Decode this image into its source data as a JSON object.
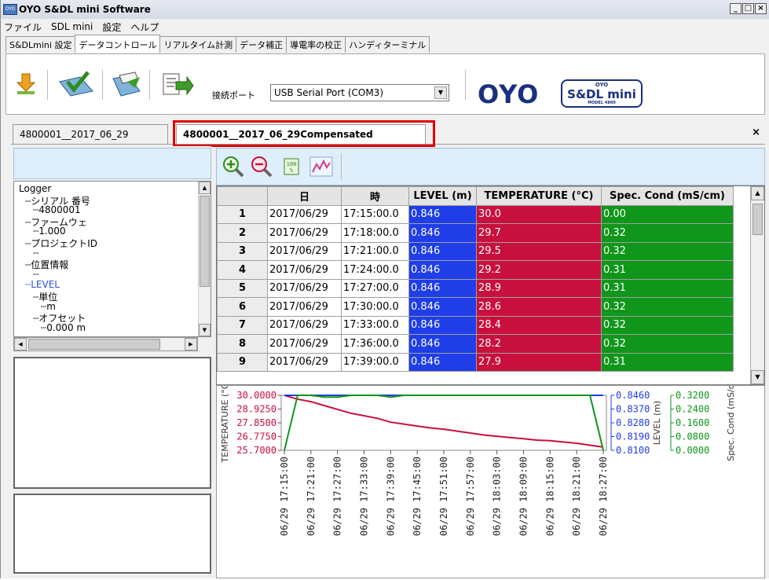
{
  "window": {
    "title": "OYO S&DL mini Software",
    "app_icon": "OYO",
    "buttons": [
      "_",
      "□",
      "×"
    ]
  },
  "menu": [
    "ファイル",
    "SDL mini",
    "設定",
    "ヘルプ"
  ],
  "tabs": [
    {
      "label": "S&DLmini 設定",
      "active": false
    },
    {
      "label": "データコントロール",
      "active": true
    },
    {
      "label": "リアルタイム計測",
      "active": false
    },
    {
      "label": "データ補正",
      "active": false
    },
    {
      "label": "導電率の校正",
      "active": false
    },
    {
      "label": "ハンディターミナル",
      "active": false
    }
  ],
  "toolbar": {
    "port_label": "接続ポート",
    "port_value": "USB Serial Port (COM3)",
    "logo_oyo": "OYO",
    "logo_sdl": "S&DL mini",
    "logo_sdl_top": "OYO",
    "logo_sdl_bottom": "MODEL 4800"
  },
  "doc_tabs": [
    {
      "label": "4800001__2017_06_29",
      "active": false
    },
    {
      "label": "4800001__2017_06_29Compensated",
      "active": true
    }
  ],
  "doc_close": "×",
  "tree": [
    {
      "text": "Logger",
      "level": 0,
      "color": "#000"
    },
    {
      "text": "シリアル 番号",
      "level": 1,
      "color": "#000"
    },
    {
      "text": "4800001",
      "level": 2,
      "color": "#000"
    },
    {
      "text": "ファームウェ",
      "level": 1,
      "color": "#000"
    },
    {
      "text": "1.000",
      "level": 2,
      "color": "#000"
    },
    {
      "text": "プロジェクトID",
      "level": 1,
      "color": "#000"
    },
    {
      "text": "",
      "level": 2,
      "color": "#000"
    },
    {
      "text": "位置情報",
      "level": 1,
      "color": "#000"
    },
    {
      "text": "",
      "level": 2,
      "color": "#000"
    },
    {
      "text": "LEVEL",
      "level": 1,
      "color": "#2b50d8"
    },
    {
      "text": "単位",
      "level": 2,
      "color": "#000"
    },
    {
      "text": "m",
      "level": 3,
      "color": "#000"
    },
    {
      "text": "オフセット",
      "level": 2,
      "color": "#000"
    },
    {
      "text": "0.000 m",
      "level": 3,
      "color": "#000"
    }
  ],
  "grid": {
    "columns": [
      "",
      "日",
      "時",
      "LEVEL (m)",
      "TEMPERATURE (°C)",
      "Spec. Cond (mS/cm)"
    ],
    "rows": [
      [
        "1",
        "2017/06/29",
        "17:15:00.0",
        "0.846",
        "30.0",
        "0.00"
      ],
      [
        "2",
        "2017/06/29",
        "17:18:00.0",
        "0.846",
        "29.7",
        "0.32"
      ],
      [
        "3",
        "2017/06/29",
        "17:21:00.0",
        "0.846",
        "29.5",
        "0.32"
      ],
      [
        "4",
        "2017/06/29",
        "17:24:00.0",
        "0.846",
        "29.2",
        "0.31"
      ],
      [
        "5",
        "2017/06/29",
        "17:27:00.0",
        "0.846",
        "28.9",
        "0.31"
      ],
      [
        "6",
        "2017/06/29",
        "17:30:00.0",
        "0.846",
        "28.6",
        "0.32"
      ],
      [
        "7",
        "2017/06/29",
        "17:33:00.0",
        "0.846",
        "28.4",
        "0.32"
      ],
      [
        "8",
        "2017/06/29",
        "17:36:00.0",
        "0.846",
        "28.2",
        "0.32"
      ],
      [
        "9",
        "2017/06/29",
        "17:39:00.0",
        "0.846",
        "27.9",
        "0.31"
      ]
    ]
  },
  "colors": {
    "level": "#1f3ee8",
    "temperature": "#c8103e",
    "cond": "#10961b"
  },
  "chart_data": {
    "type": "line",
    "x": [
      "06/29 17:15:00",
      "06/29 17:18:00",
      "06/29 17:21:00",
      "06/29 17:24:00",
      "06/29 17:27:00",
      "06/29 17:30:00",
      "06/29 17:33:00",
      "06/29 17:36:00",
      "06/29 17:39:00",
      "06/29 17:42:00",
      "06/29 17:45:00",
      "06/29 17:48:00",
      "06/29 17:51:00",
      "06/29 17:54:00",
      "06/29 17:57:00",
      "06/29 18:00:00",
      "06/29 18:03:00",
      "06/29 18:06:00",
      "06/29 18:09:00",
      "06/29 18:12:00",
      "06/29 18:15:00",
      "06/29 18:18:00",
      "06/29 18:21:00",
      "06/29 18:24:00",
      "06/29 18:27:00"
    ],
    "x_ticks": [
      "06/29 17:15:00",
      "06/29 17:21:00",
      "06/29 17:27:00",
      "06/29 17:33:00",
      "06/29 17:39:00",
      "06/29 17:45:00",
      "06/29 17:51:00",
      "06/29 17:57:00",
      "06/29 18:03:00",
      "06/29 18:09:00",
      "06/29 18:15:00",
      "06/29 18:21:00",
      "06/29 18:27:00"
    ],
    "series": [
      {
        "name": "TEMPERATURE (°C)",
        "axis": "left",
        "color": "#c8103e",
        "values": [
          30.0,
          29.7,
          29.5,
          29.2,
          28.9,
          28.6,
          28.4,
          28.2,
          27.9,
          27.75,
          27.6,
          27.45,
          27.35,
          27.2,
          27.05,
          26.9,
          26.8,
          26.7,
          26.6,
          26.5,
          26.45,
          26.35,
          26.25,
          26.1,
          25.95
        ]
      },
      {
        "name": "LEVEL (m)",
        "axis": "right1",
        "color": "#1f3ee8",
        "values": [
          0.846,
          0.846,
          0.846,
          0.846,
          0.846,
          0.846,
          0.846,
          0.846,
          0.846,
          0.846,
          0.846,
          0.846,
          0.846,
          0.846,
          0.846,
          0.846,
          0.846,
          0.846,
          0.846,
          0.846,
          0.846,
          0.846,
          0.846,
          0.846,
          0.846
        ]
      },
      {
        "name": "Spec. Cond (mS/cm)",
        "axis": "right2",
        "color": "#10961b",
        "values": [
          0.0,
          0.32,
          0.32,
          0.31,
          0.31,
          0.32,
          0.32,
          0.32,
          0.31,
          0.32,
          0.32,
          0.32,
          0.32,
          0.32,
          0.32,
          0.32,
          0.32,
          0.32,
          0.32,
          0.32,
          0.32,
          0.32,
          0.32,
          0.32,
          0.0
        ]
      }
    ],
    "left_axis": {
      "label": "TEMPERATURE (°C",
      "ticks": [
        "30.0000",
        "28.9250",
        "27.8500",
        "26.7750",
        "25.7000"
      ],
      "min": 25.7,
      "max": 30.0
    },
    "right1_axis": {
      "label": "LEVEL (m)",
      "ticks": [
        "0.8460",
        "0.8370",
        "0.8280",
        "0.8190",
        "0.8100"
      ],
      "min": 0.81,
      "max": 0.846
    },
    "right2_axis": {
      "label": "Spec. Cond (mS/c",
      "ticks": [
        "0.3200",
        "0.2400",
        "0.1600",
        "0.0800",
        "0.0000"
      ],
      "min": 0.0,
      "max": 0.32
    }
  }
}
